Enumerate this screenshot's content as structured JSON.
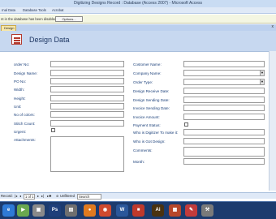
{
  "window": {
    "title": "Digitizing Designs Record : Database (Access 2007) - Microsoft Access"
  },
  "ribbon": {
    "tabs": [
      "rnal Data",
      "Database Tools",
      "Acrobat"
    ]
  },
  "message_bar": {
    "text": "nt in the database has been disabled",
    "options_button": "Options..."
  },
  "document_tab": {
    "label": "Design Data",
    "close_glyph": "x"
  },
  "form": {
    "title": "Design Data",
    "left_fields": [
      {
        "label": "order No:"
      },
      {
        "label": "Design Name:"
      },
      {
        "label": "PO No:"
      },
      {
        "label": "Width:"
      },
      {
        "label": "Height:"
      },
      {
        "label": "Unit:"
      },
      {
        "label": "No of colors:"
      },
      {
        "label": "Stitch Count:"
      },
      {
        "label": "Urgent:"
      },
      {
        "label": "Attachments:"
      }
    ],
    "right_fields": [
      {
        "label": "Costomer Name:"
      },
      {
        "label": "Company Name:"
      },
      {
        "label": "Order Type:"
      },
      {
        "label": "Design Receive Date:"
      },
      {
        "label": "Design Sending Date:"
      },
      {
        "label": "Invoice Sending Date:"
      },
      {
        "label": "Invoice Amount:"
      },
      {
        "label": "Payment Status:"
      },
      {
        "label": "Who is Digitizer To make it:"
      },
      {
        "label": "Who is Got Design:"
      },
      {
        "label": "Comments:"
      },
      {
        "label": "Month:"
      }
    ]
  },
  "nav_bar": {
    "record_label": "Record:",
    "position": "1 of 1",
    "filter_status": "Unfiltered",
    "search_label": "Search"
  },
  "taskbar": {
    "apps": [
      {
        "glyph": "e",
        "color": "#2f7ad6"
      },
      {
        "glyph": "▶",
        "color": "#6aa84f"
      },
      {
        "glyph": "▣",
        "color": "#8a8a8a"
      },
      {
        "glyph": "Ps",
        "color": "#1f3f7a"
      },
      {
        "glyph": "▤",
        "color": "#6f6f6f"
      },
      {
        "glyph": "●",
        "color": "#e07a1f"
      },
      {
        "glyph": "◉",
        "color": "#d04a2f"
      },
      {
        "glyph": "W",
        "color": "#2b579a"
      },
      {
        "glyph": "■",
        "color": "#c0392b"
      },
      {
        "glyph": "Ai",
        "color": "#4a3210"
      },
      {
        "glyph": "▦",
        "color": "#b7472a"
      },
      {
        "glyph": "✎",
        "color": "#c23b3b"
      },
      {
        "glyph": "⚒",
        "color": "#7a7a7a"
      }
    ]
  }
}
